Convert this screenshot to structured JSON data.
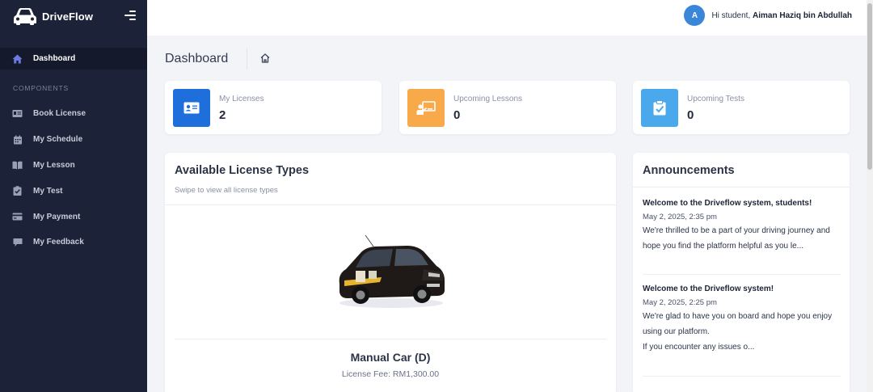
{
  "app": {
    "name": "DriveFlow"
  },
  "sidebar": {
    "active": {
      "label": "Dashboard",
      "icon": "home-icon"
    },
    "section_title": "COMPONENTS",
    "items": [
      {
        "label": "Book License",
        "icon": "id-card-icon"
      },
      {
        "label": "My Schedule",
        "icon": "calendar-icon"
      },
      {
        "label": "My Lesson",
        "icon": "book-icon"
      },
      {
        "label": "My Test",
        "icon": "clipboard-check-icon"
      },
      {
        "label": "My Payment",
        "icon": "credit-card-icon"
      },
      {
        "label": "My Feedback",
        "icon": "comment-icon"
      }
    ]
  },
  "topbar": {
    "avatar_initial": "A",
    "greeting": "Hi student,",
    "user_name": "Aiman Haziq bin Abdullah"
  },
  "page": {
    "title": "Dashboard"
  },
  "stats": [
    {
      "label": "My Licenses",
      "value": "2",
      "color": "#1e6fdc",
      "icon": "id-card-icon"
    },
    {
      "label": "Upcoming Lessons",
      "value": "0",
      "color": "#f8a94a",
      "icon": "teacher-icon"
    },
    {
      "label": "Upcoming Tests",
      "value": "0",
      "color": "#4aa8ec",
      "icon": "clipboard-check-icon"
    }
  ],
  "licenses": {
    "title": "Available License Types",
    "subtitle": "Swipe to view all license types",
    "current": {
      "name": "Manual Car (D)",
      "fee": "License Fee: RM1,300.00"
    }
  },
  "announcements": {
    "title": "Announcements",
    "items": [
      {
        "title": "Welcome to the Driveflow system, students!",
        "date": "May 2, 2025, 2:35 pm",
        "body": "We're thrilled to be a part of your driving journey and hope you find the platform helpful as you le..."
      },
      {
        "title": "Welcome to the Driveflow system!",
        "date": "May 2, 2025, 2:25 pm",
        "body1": "We're glad to have you on board and hope you enjoy using our platform.",
        "body2": "If you encounter any issues o..."
      }
    ]
  },
  "colors": {
    "sidebar_bg": "#1c2237",
    "active_bg": "#141a2b",
    "accent": "#6c7ae0",
    "page_bg": "#f3f4f8"
  }
}
